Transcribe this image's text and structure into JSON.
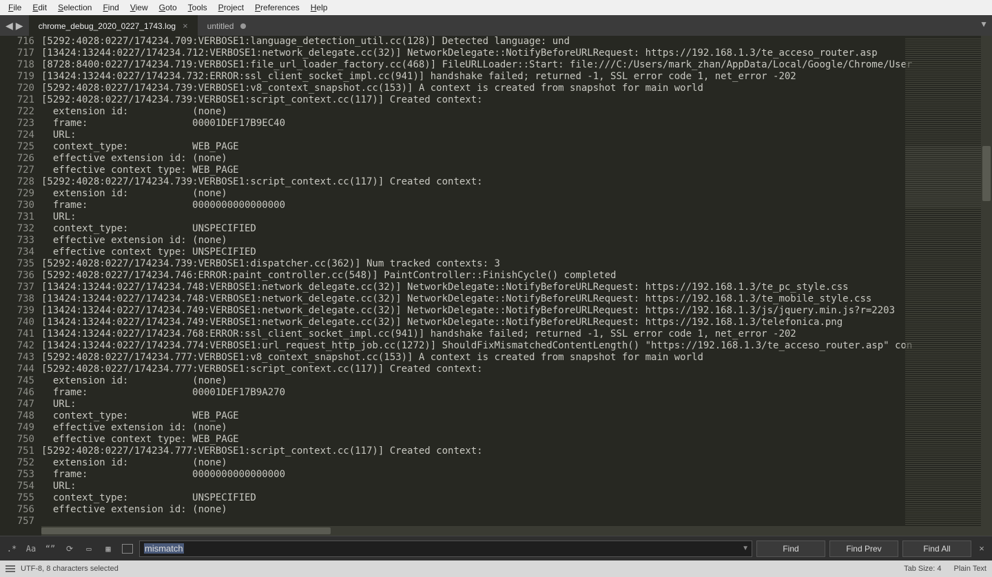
{
  "menu": {
    "items": [
      "File",
      "Edit",
      "Selection",
      "Find",
      "View",
      "Goto",
      "Tools",
      "Project",
      "Preferences",
      "Help"
    ]
  },
  "tabs": [
    {
      "label": "chrome_debug_2020_0227_1743.log",
      "active": true,
      "dirty": false
    },
    {
      "label": "untitled",
      "active": false,
      "dirty": true
    }
  ],
  "editor": {
    "first_line_no": 716,
    "marked_lines": [
      725,
      732,
      748,
      755
    ],
    "highlight": {
      "line": 743,
      "word": "Mismatch"
    },
    "lines": [
      "[5292:4028:0227/174234.709:VERBOSE1:language_detection_util.cc(128)] Detected language: und",
      "[13424:13244:0227/174234.712:VERBOSE1:network_delegate.cc(32)] NetworkDelegate::NotifyBeforeURLRequest: https://192.168.1.3/te_acceso_router.asp",
      "[8728:8400:0227/174234.719:VERBOSE1:file_url_loader_factory.cc(468)] FileURLLoader::Start: file:///C:/Users/mark_zhan/AppData/Local/Google/Chrome/User",
      "[13424:13244:0227/174234.732:ERROR:ssl_client_socket_impl.cc(941)] handshake failed; returned -1, SSL error code 1, net_error -202",
      "[5292:4028:0227/174234.739:VERBOSE1:v8_context_snapshot.cc(153)] A context is created from snapshot for main world",
      "[5292:4028:0227/174234.739:VERBOSE1:script_context.cc(117)] Created context:",
      "  extension id:           (none)",
      "  frame:                  00001DEF17B9EC40",
      "  URL:",
      "  context_type:           WEB_PAGE",
      "  effective extension id: (none)",
      "  effective context type: WEB_PAGE",
      "[5292:4028:0227/174234.739:VERBOSE1:script_context.cc(117)] Created context:",
      "  extension id:           (none)",
      "  frame:                  0000000000000000",
      "  URL:",
      "  context_type:           UNSPECIFIED",
      "  effective extension id: (none)",
      "  effective context type: UNSPECIFIED",
      "[5292:4028:0227/174234.739:VERBOSE1:dispatcher.cc(362)] Num tracked contexts: 3",
      "[5292:4028:0227/174234.746:ERROR:paint_controller.cc(548)] PaintController::FinishCycle() completed",
      "[13424:13244:0227/174234.748:VERBOSE1:network_delegate.cc(32)] NetworkDelegate::NotifyBeforeURLRequest: https://192.168.1.3/te_pc_style.css",
      "[13424:13244:0227/174234.748:VERBOSE1:network_delegate.cc(32)] NetworkDelegate::NotifyBeforeURLRequest: https://192.168.1.3/te_mobile_style.css",
      "[13424:13244:0227/174234.749:VERBOSE1:network_delegate.cc(32)] NetworkDelegate::NotifyBeforeURLRequest: https://192.168.1.3/js/jquery.min.js?r=2203",
      "[13424:13244:0227/174234.749:VERBOSE1:network_delegate.cc(32)] NetworkDelegate::NotifyBeforeURLRequest: https://192.168.1.3/telefonica.png",
      "[13424:13244:0227/174234.768:ERROR:ssl_client_socket_impl.cc(941)] handshake failed; returned -1, SSL error code 1, net_error -202",
      "[13424:13244:0227/174234.774:VERBOSE1:url_request_http_job.cc(1272)] ShouldFixMismatchedContentLength() \"https://192.168.1.3/te_acceso_router.asp\" con",
      "[5292:4028:0227/174234.777:VERBOSE1:v8_context_snapshot.cc(153)] A context is created from snapshot for main world",
      "[5292:4028:0227/174234.777:VERBOSE1:script_context.cc(117)] Created context:",
      "  extension id:           (none)",
      "  frame:                  00001DEF17B9A270",
      "  URL:",
      "  context_type:           WEB_PAGE",
      "  effective extension id: (none)",
      "  effective context type: WEB_PAGE",
      "[5292:4028:0227/174234.777:VERBOSE1:script_context.cc(117)] Created context:",
      "  extension id:           (none)",
      "  frame:                  0000000000000000",
      "  URL:",
      "  context_type:           UNSPECIFIED",
      "  effective extension id: (none)",
      ""
    ]
  },
  "find": {
    "regex_icon": ".*",
    "case_icon": "Aa",
    "word_icon": "“”",
    "wrap_icon": "⟳",
    "sel_icon": "▭",
    "highlight_icon": "▦",
    "query": "mismatch",
    "btn_find": "Find",
    "btn_prev": "Find Prev",
    "btn_all": "Find All"
  },
  "status": {
    "encoding": "UTF-8, 8 characters selected",
    "tabsize": "Tab Size: 4",
    "syntax": "Plain Text"
  }
}
